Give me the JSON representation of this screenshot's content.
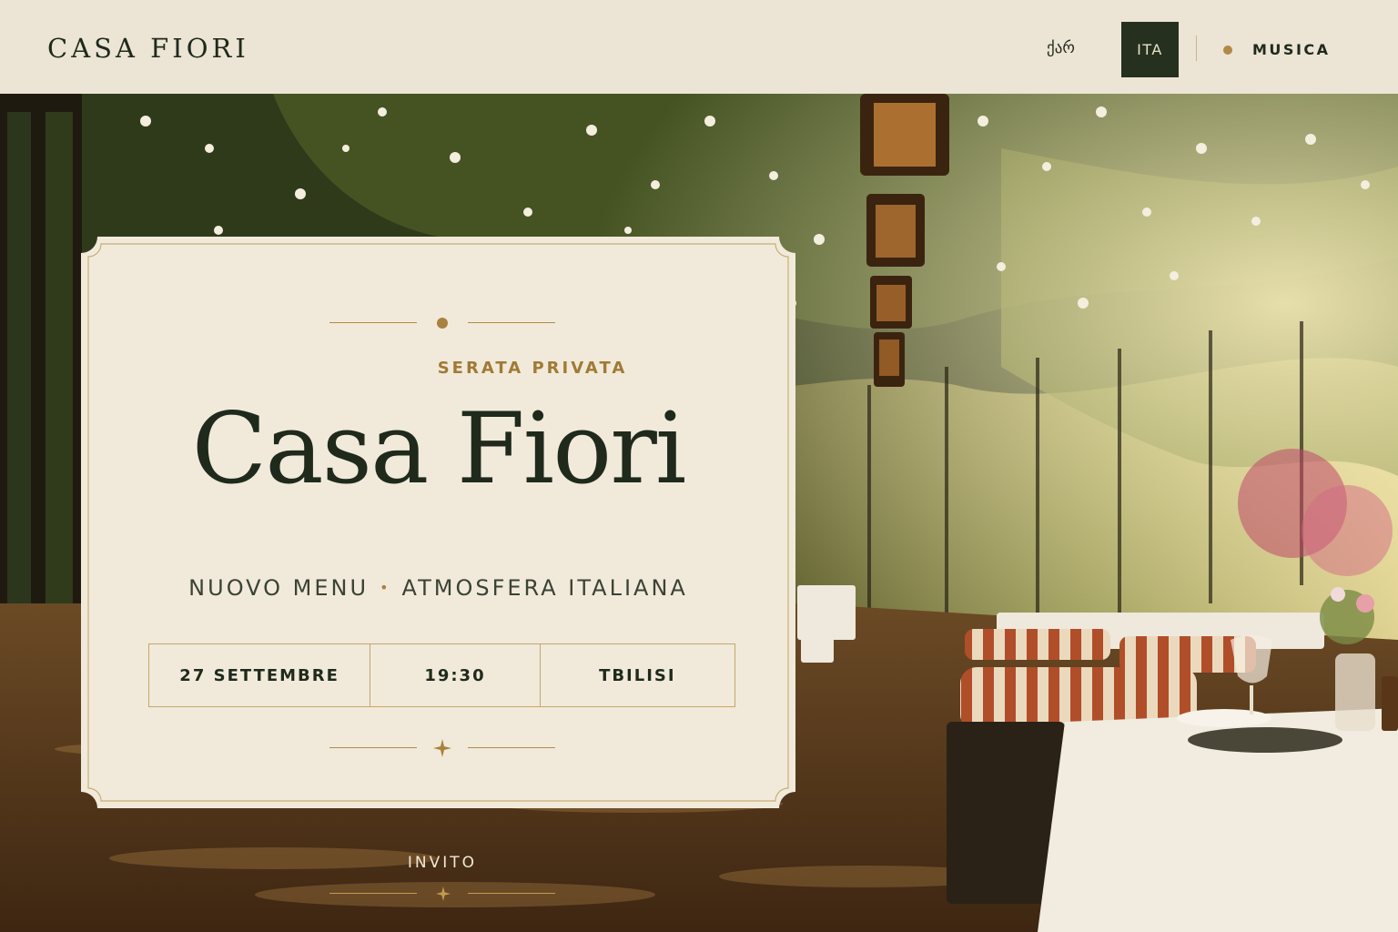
{
  "header": {
    "logo": "CASA FIORI",
    "lang_georgian": "ქარ",
    "lang_italian": "ITA",
    "lang_italian_active": true,
    "music_label": "MUSICA"
  },
  "card": {
    "eyebrow": "SERATA PRIVATA",
    "title": "Casa Fiori",
    "subtitle_left": "NUOVO MENU",
    "subtitle_separator": "•",
    "subtitle_right": "ATMOSFERA ITALIANA",
    "details": {
      "date": "27 SETTEMBRE",
      "time": "19:30",
      "city": "TBILISI"
    }
  },
  "footer": {
    "invito_label": "INVITO"
  },
  "colors": {
    "header_bg": "#ece4d4",
    "card_bg": "#f1eadb",
    "dark_green": "#1f2a1c",
    "gold": "#b08a45"
  },
  "icons": [
    "music-dot-icon",
    "ornament-dot-icon",
    "ornament-star-icon"
  ]
}
